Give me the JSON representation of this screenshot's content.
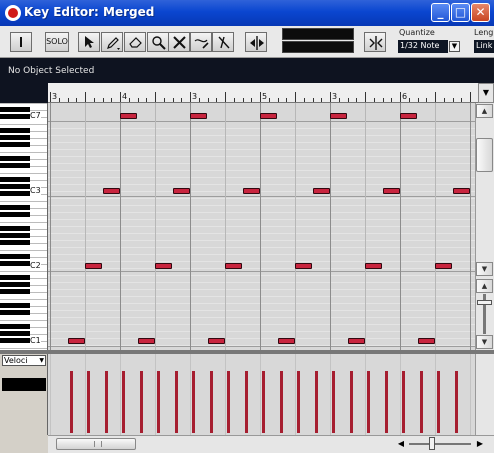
{
  "window": {
    "title": "Key Editor: Merged"
  },
  "toolbar": {
    "solo_label": "SOLO",
    "quantize_label": "Quantize",
    "quantize_value": "1/32 Note",
    "length_label": "Leng",
    "length_value": "Link"
  },
  "info": {
    "text": "No Object Selected"
  },
  "ruler": {
    "bars": [
      "3",
      "4",
      "3",
      "5",
      "3",
      "6"
    ]
  },
  "keyboard": {
    "labels": [
      "C7",
      "C3",
      "C2",
      "C1"
    ]
  },
  "velocity": {
    "lane_label": "Veloci"
  },
  "colors": {
    "note": "#c8243e",
    "velocity": "#a61e30",
    "title_bar": "#0a46d0"
  },
  "notes": {
    "c4_starts": [
      1,
      2,
      3,
      4,
      5
    ],
    "c3_starts": [
      0.75,
      1.75,
      2.75,
      3.75,
      4.75,
      5.75
    ],
    "c2_starts": [
      0.5,
      1.5,
      2.5,
      3.5,
      4.5,
      5.5
    ],
    "c1_starts": [
      0.25,
      1.25,
      2.25,
      3.25,
      4.25,
      5.25
    ]
  }
}
